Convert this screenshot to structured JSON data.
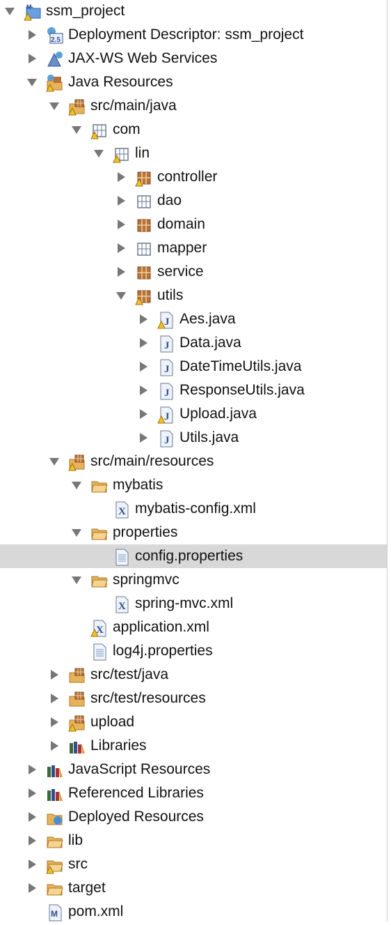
{
  "colors": {
    "selection": "#d8d8d8",
    "arrow": "#777777",
    "folder": "#e8b25a",
    "package": "#b8733a",
    "warning": "#f2c230"
  },
  "tree": [
    {
      "label": "ssm_project",
      "level": 0,
      "expanded": true,
      "icon": "project-icon",
      "warn": true
    },
    {
      "label": "Deployment Descriptor: ssm_project",
      "level": 1,
      "expanded": false,
      "icon": "deployment-descriptor-icon"
    },
    {
      "label": "JAX-WS Web Services",
      "level": 1,
      "expanded": false,
      "icon": "web-services-icon"
    },
    {
      "label": "Java Resources",
      "level": 1,
      "expanded": true,
      "icon": "java-resources-icon",
      "warn": true
    },
    {
      "label": "src/main/java",
      "level": 2,
      "expanded": true,
      "icon": "source-folder-icon",
      "warn": true
    },
    {
      "label": "com",
      "level": 3,
      "expanded": true,
      "icon": "empty-package-icon",
      "warn": true
    },
    {
      "label": "lin",
      "level": 4,
      "expanded": true,
      "icon": "empty-package-icon",
      "warn": true
    },
    {
      "label": "controller",
      "level": 5,
      "expanded": false,
      "icon": "package-icon",
      "warn": true
    },
    {
      "label": "dao",
      "level": 5,
      "expanded": false,
      "icon": "empty-package-icon"
    },
    {
      "label": "domain",
      "level": 5,
      "expanded": false,
      "icon": "package-icon"
    },
    {
      "label": "mapper",
      "level": 5,
      "expanded": false,
      "icon": "empty-package-icon"
    },
    {
      "label": "service",
      "level": 5,
      "expanded": false,
      "icon": "package-icon"
    },
    {
      "label": "utils",
      "level": 5,
      "expanded": true,
      "icon": "package-icon",
      "warn": true
    },
    {
      "label": "Aes.java",
      "level": 6,
      "expanded": false,
      "icon": "java-file-icon",
      "warn": true
    },
    {
      "label": "Data.java",
      "level": 6,
      "expanded": false,
      "icon": "java-file-icon"
    },
    {
      "label": "DateTimeUtils.java",
      "level": 6,
      "expanded": false,
      "icon": "java-file-icon"
    },
    {
      "label": "ResponseUtils.java",
      "level": 6,
      "expanded": false,
      "icon": "java-file-icon"
    },
    {
      "label": "Upload.java",
      "level": 6,
      "expanded": false,
      "icon": "java-file-icon",
      "warn": true
    },
    {
      "label": "Utils.java",
      "level": 6,
      "expanded": false,
      "icon": "java-file-icon"
    },
    {
      "label": "src/main/resources",
      "level": 2,
      "expanded": true,
      "icon": "source-folder-icon",
      "warn": true
    },
    {
      "label": "mybatis",
      "level": 3,
      "expanded": true,
      "icon": "folder-icon"
    },
    {
      "label": "mybatis-config.xml",
      "level": 4,
      "expanded": null,
      "icon": "xml-file-icon"
    },
    {
      "label": "properties",
      "level": 3,
      "expanded": true,
      "icon": "folder-icon"
    },
    {
      "label": "config.properties",
      "level": 4,
      "expanded": null,
      "icon": "text-file-icon",
      "selected": true
    },
    {
      "label": "springmvc",
      "level": 3,
      "expanded": true,
      "icon": "folder-icon"
    },
    {
      "label": "spring-mvc.xml",
      "level": 4,
      "expanded": null,
      "icon": "xml-file-icon"
    },
    {
      "label": "application.xml",
      "level": 3,
      "expanded": null,
      "icon": "xml-file-icon",
      "warn": true
    },
    {
      "label": "log4j.properties",
      "level": 3,
      "expanded": null,
      "icon": "text-file-icon"
    },
    {
      "label": "src/test/java",
      "level": 2,
      "expanded": false,
      "icon": "source-folder-icon"
    },
    {
      "label": "src/test/resources",
      "level": 2,
      "expanded": false,
      "icon": "source-folder-icon"
    },
    {
      "label": "upload",
      "level": 2,
      "expanded": false,
      "icon": "source-folder-icon",
      "warn": true
    },
    {
      "label": "Libraries",
      "level": 2,
      "expanded": false,
      "icon": "library-icon"
    },
    {
      "label": "JavaScript Resources",
      "level": 1,
      "expanded": false,
      "icon": "library-icon"
    },
    {
      "label": "Referenced Libraries",
      "level": 1,
      "expanded": false,
      "icon": "library-icon"
    },
    {
      "label": "Deployed Resources",
      "level": 1,
      "expanded": false,
      "icon": "deployed-resources-icon"
    },
    {
      "label": "lib",
      "level": 1,
      "expanded": false,
      "icon": "folder-icon"
    },
    {
      "label": "src",
      "level": 1,
      "expanded": false,
      "icon": "folder-icon",
      "warn": true
    },
    {
      "label": "target",
      "level": 1,
      "expanded": false,
      "icon": "folder-icon"
    },
    {
      "label": "pom.xml",
      "level": 1,
      "expanded": null,
      "icon": "maven-file-icon"
    }
  ]
}
